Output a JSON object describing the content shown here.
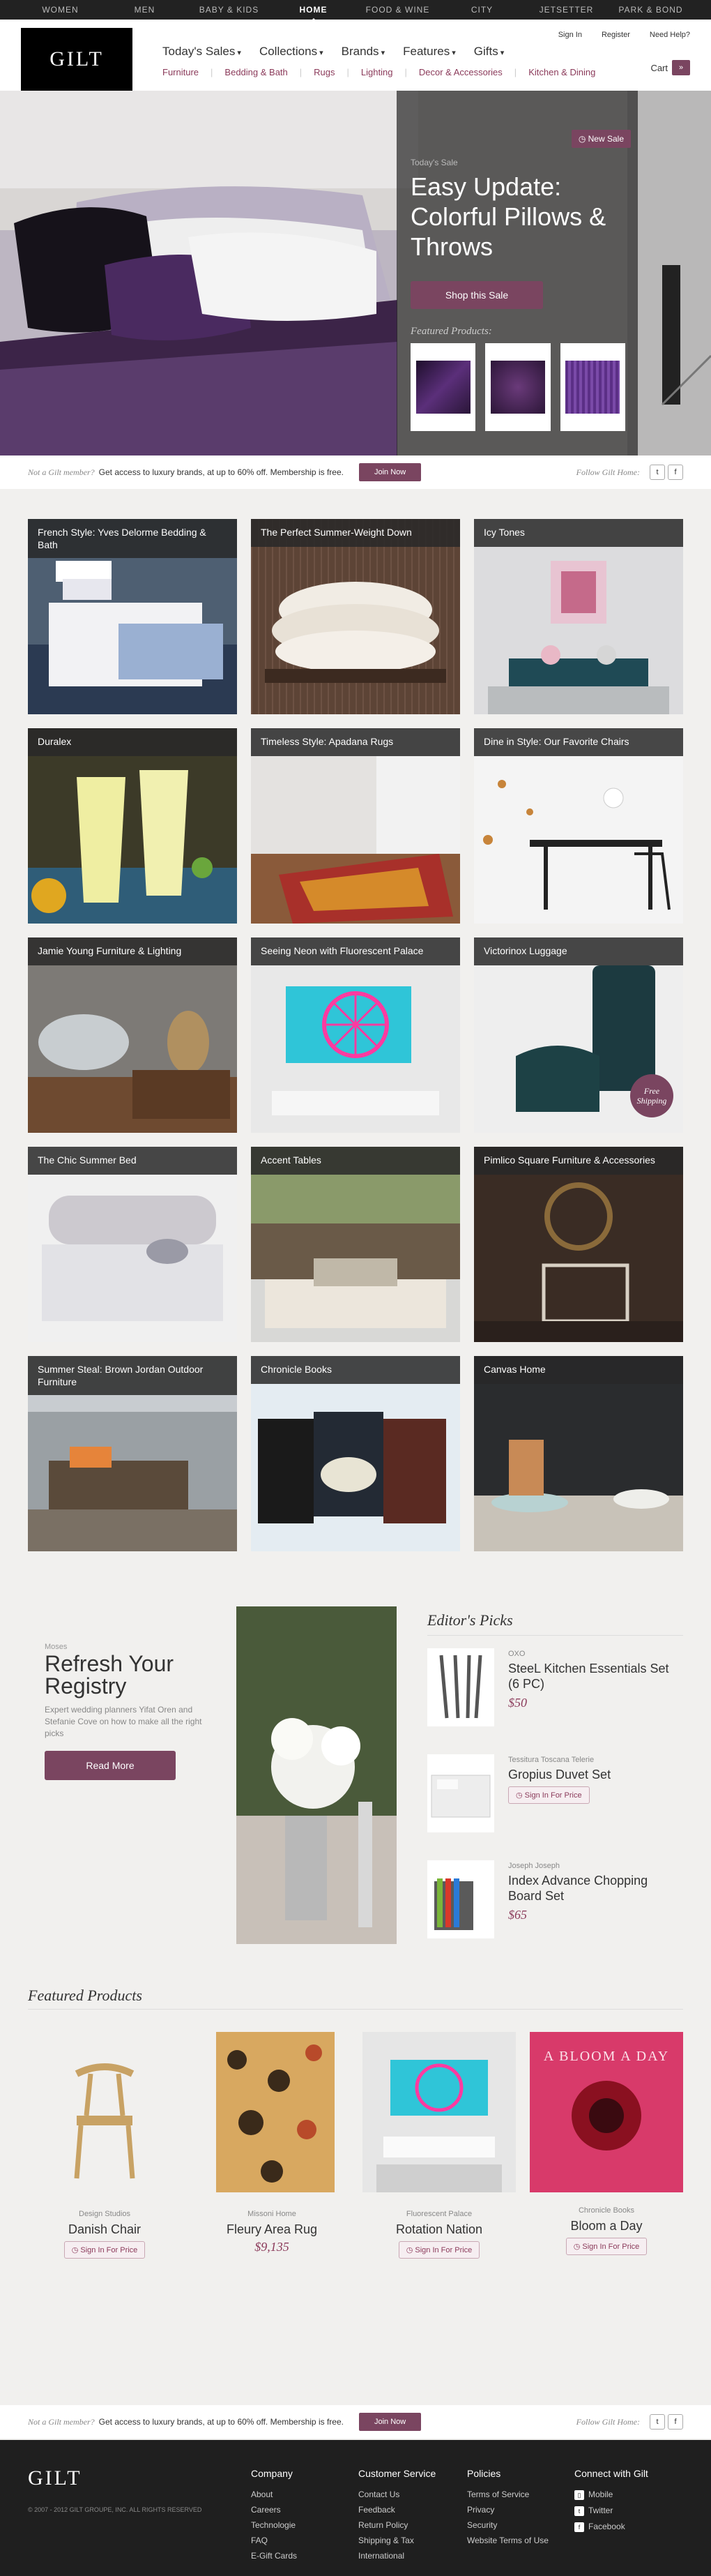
{
  "topnav": [
    {
      "label": "WOMEN",
      "active": false
    },
    {
      "label": "MEN",
      "active": false
    },
    {
      "label": "BABY & KIDS",
      "active": false
    },
    {
      "label": "HOME",
      "active": true
    },
    {
      "label": "FOOD & WINE",
      "active": false
    },
    {
      "label": "CITY",
      "active": false
    },
    {
      "label": "JETSETTER",
      "active": false
    },
    {
      "label": "PARK & BOND",
      "active": false
    }
  ],
  "logo": "GILT",
  "utility": {
    "signin": "Sign In",
    "register": "Register",
    "help": "Need Help?"
  },
  "mainnav": [
    "Today's Sales",
    "Collections",
    "Brands",
    "Features",
    "Gifts"
  ],
  "subnav": [
    "Furniture",
    "Bedding & Bath",
    "Rugs",
    "Lighting",
    "Decor & Accessories",
    "Kitchen & Dining"
  ],
  "cart": {
    "label": "Cart",
    "icon": "chevron-right-icon"
  },
  "hero": {
    "badge": "New Sale",
    "kicker": "Today's Sale",
    "title": "Easy Update: Colorful Pillows & Throws",
    "cta": "Shop this Sale",
    "featured_label": "Featured Products:"
  },
  "member": {
    "prompt": "Not a Gilt member?",
    "text": "Get access to luxury brands, at up to 60% off. Membership is free.",
    "join": "Join Now",
    "follow": "Follow Gilt Home:",
    "twitter": "t",
    "facebook": "f"
  },
  "tiles": [
    {
      "label": "French Style: Yves Delorme Bedding & Bath"
    },
    {
      "label": "The Perfect Summer-Weight Down"
    },
    {
      "label": "Icy Tones"
    },
    {
      "label": "Duralex"
    },
    {
      "label": "Timeless Style: Apadana Rugs"
    },
    {
      "label": "Dine in Style: Our Favorite Chairs"
    },
    {
      "label": "Jamie Young Furniture & Lighting"
    },
    {
      "label": "Seeing Neon with Fluorescent Palace"
    },
    {
      "label": "Victorinox Luggage",
      "badge": "Free Shipping"
    },
    {
      "label": "The Chic Summer Bed"
    },
    {
      "label": "Accent Tables"
    },
    {
      "label": "Pimlico Square Furniture & Accessories"
    },
    {
      "label": "Summer Steal: Brown Jordan Outdoor Furniture"
    },
    {
      "label": "Chronicle Books"
    },
    {
      "label": "Canvas Home"
    }
  ],
  "registry": {
    "brand": "Moses",
    "title": "Refresh Your Registry",
    "text": "Expert wedding planners Yifat Oren and Stefanie Cove on how to make all the right picks",
    "cta": "Read More"
  },
  "editors_picks": {
    "title": "Editor's Picks",
    "items": [
      {
        "brand": "OXO",
        "name": "SteeL Kitchen Essentials Set (6 PC)",
        "price": "$50"
      },
      {
        "brand": "Tessitura Toscana Telerie",
        "name": "Gropius Duvet Set",
        "signin": "Sign In For Price"
      },
      {
        "brand": "Joseph Joseph",
        "name": "Index Advance Chopping Board Set",
        "price": "$65"
      }
    ]
  },
  "featured_products": {
    "title": "Featured Products",
    "items": [
      {
        "brand": "Design Studios",
        "name": "Danish Chair",
        "signin": "Sign In For Price"
      },
      {
        "brand": "Missoni Home",
        "name": "Fleury Area Rug",
        "price": "$9,135"
      },
      {
        "brand": "Fluorescent Palace",
        "name": "Rotation Nation",
        "signin": "Sign In For Price"
      },
      {
        "brand": "Chronicle Books",
        "name": "Bloom a Day",
        "signin": "Sign In For Price"
      }
    ],
    "book_cover_text": "A BLOOM A DAY"
  },
  "footer": {
    "logo": "GILT",
    "copyright": "© 2007 - 2012 GILT GROUPE, INC. ALL RIGHTS RESERVED",
    "columns": [
      {
        "title": "Company",
        "links": [
          "About",
          "Careers",
          "Technologie",
          "FAQ",
          "E-Gift Cards"
        ]
      },
      {
        "title": "Customer Service",
        "links": [
          "Contact Us",
          "Feedback",
          "Return Policy",
          "Shipping & Tax",
          "International"
        ]
      },
      {
        "title": "Policies",
        "links": [
          "Terms of Service",
          "Privacy",
          "Security",
          "Website Terms of Use"
        ]
      },
      {
        "title": "Connect with Gilt",
        "links": [
          "Mobile",
          "Twitter",
          "Facebook"
        ]
      }
    ]
  },
  "colors": {
    "accent": "#7a4560",
    "link": "#8b3a5a",
    "dark": "#222222",
    "panel": "#f1f0ee"
  }
}
